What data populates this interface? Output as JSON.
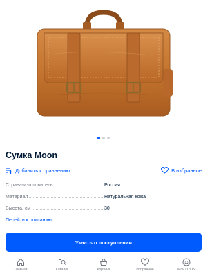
{
  "product": {
    "title": "Сумка Moon",
    "image_alt": "leather-messenger-bag",
    "gallery_dots": 3,
    "active_dot": 0
  },
  "actions": {
    "compare_label": "Добавить к сравнению",
    "compare_icon": "add-to-list-icon",
    "favorite_label": "В избранное",
    "favorite_icon": "heart-outline-icon"
  },
  "specs": [
    {
      "label": "Страна-изготовитель",
      "value": "Россия"
    },
    {
      "label": "Материал",
      "value": "Натуральная кожа"
    },
    {
      "label": "Высота, см",
      "value": "30"
    }
  ],
  "description_link": "Перейти к описанию",
  "notify_button": "Узнать о поступлении",
  "tabbar": [
    {
      "label": "Главная",
      "icon": "home-icon"
    },
    {
      "label": "Каталог",
      "icon": "catalog-search-icon"
    },
    {
      "label": "Корзина",
      "icon": "basket-icon"
    },
    {
      "label": "Избранное",
      "icon": "heart-icon"
    },
    {
      "label": "Мой OZON",
      "icon": "profile-smile-icon"
    }
  ],
  "colors": {
    "accent": "#005bff",
    "text": "#001a34",
    "muted": "#70757f",
    "leather": "#c4742e"
  }
}
